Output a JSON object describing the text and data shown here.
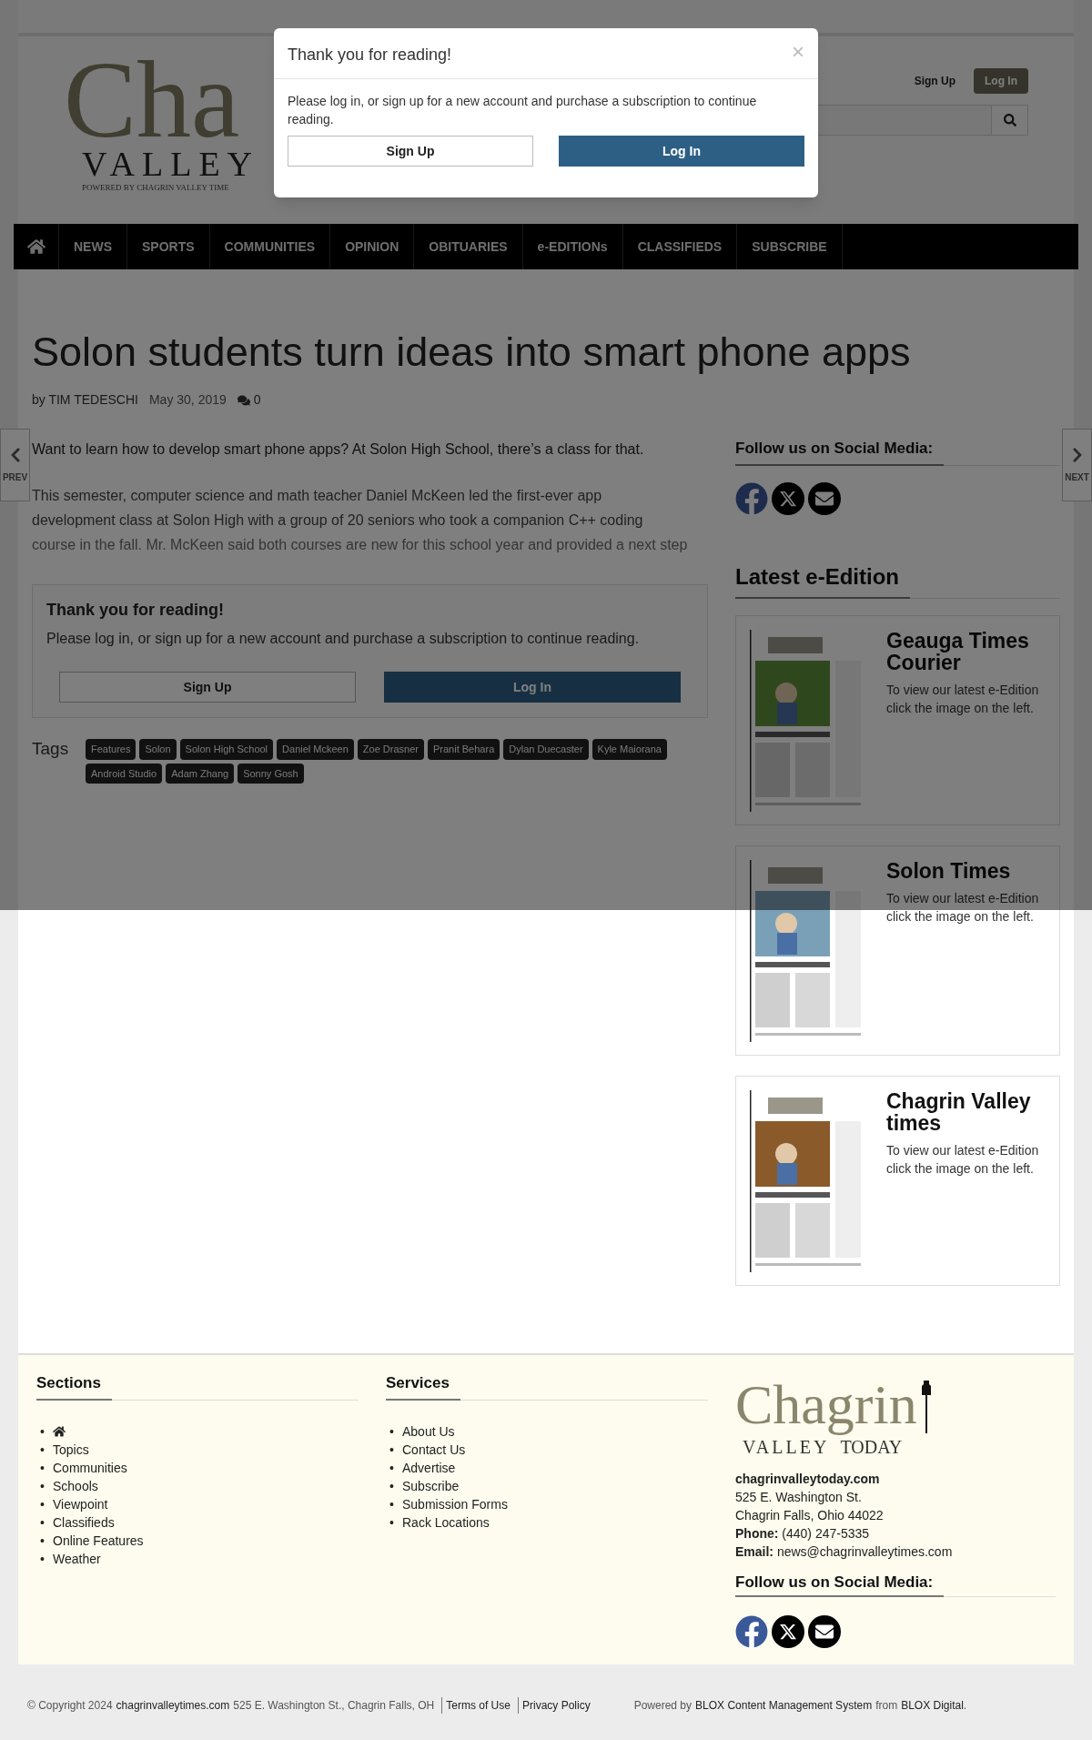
{
  "header": {
    "logo": {
      "line_1": "Cha",
      "line_2": "VALLEY",
      "tagline": "POWERED BY CHAGRIN VALLEY TIME"
    },
    "sign_up": "Sign Up",
    "log_in": "Log In"
  },
  "nav": [
    {
      "kind": "home"
    },
    {
      "kind": "link",
      "label": "NEWS"
    },
    {
      "kind": "link",
      "label": "SPORTS"
    },
    {
      "kind": "link",
      "label": "COMMUNITIES"
    },
    {
      "kind": "link",
      "label": "OPINION"
    },
    {
      "kind": "link",
      "label": "OBITUARIES"
    },
    {
      "kind": "link",
      "label": "e-EDITIONs"
    },
    {
      "kind": "link",
      "label": "CLASSIFIEDS"
    },
    {
      "kind": "link",
      "label": "SUBSCRIBE"
    }
  ],
  "pager": {
    "prev": "PREV",
    "next": "NEXT"
  },
  "article": {
    "title": "Solon students turn ideas into smart phone apps",
    "author": "by TIM TEDESCHI",
    "date": "May 30, 2019",
    "comments": "0",
    "paragraphs": [
      "Want to learn how to develop smart phone apps? At Solon High School, there’s a class for that.",
      "This semester, computer science and math teacher Daniel McKeen led the first-ever app development class at Solon High with a group of 20 seniors who took a companion C++ coding",
      "course in the fall. Mr. McKeen said both courses are new for this school year and provided a next step"
    ]
  },
  "paywall": {
    "title": "Thank you for reading!",
    "text": "Please log in, or sign up for a new account and purchase a subscription to continue reading.",
    "sign_up": "Sign Up",
    "log_in": "Log In"
  },
  "tags": {
    "label": "Tags",
    "items": [
      "Features",
      "Solon",
      "Solon High School",
      "Daniel Mckeen",
      "Zoe Drasner",
      "Pranit Behara",
      "Dylan Duecaster",
      "Kyle Maiorana",
      "Android Studio",
      "Adam Zhang",
      "Sonny Gosh"
    ]
  },
  "sidebar": {
    "social_heading": "Follow us on Social Media:",
    "social": [
      {
        "kind": "facebook"
      },
      {
        "kind": "x"
      },
      {
        "kind": "email"
      }
    ],
    "editions_heading": "Latest e-Edition",
    "editions": [
      {
        "title": "Geauga Times Courier",
        "text": "To view our latest e-Edition click the image on the left."
      },
      {
        "title": "Solon Times",
        "text": "To view our latest e-Edition click the image on the left."
      },
      {
        "title": "Chagrin Valley times",
        "text": "To view our latest e-Edition click the image on the left."
      }
    ]
  },
  "footer": {
    "sections": {
      "heading": "Sections",
      "marker": "•",
      "items": [
        {
          "kind": "home"
        },
        {
          "kind": "link",
          "label": "Topics"
        },
        {
          "kind": "link",
          "label": "Communities"
        },
        {
          "kind": "link",
          "label": "Schools"
        },
        {
          "kind": "link",
          "label": "Viewpoint"
        },
        {
          "kind": "link",
          "label": "Classifieds"
        },
        {
          "kind": "link",
          "label": "Online Features"
        },
        {
          "kind": "link",
          "label": "Weather"
        }
      ]
    },
    "services": {
      "heading": "Services",
      "marker": "•",
      "items": [
        "About Us",
        "Contact Us",
        "Advertise",
        "Subscribe",
        "Submission Forms",
        "Rack Locations"
      ]
    },
    "logo": {
      "word": "Chagrin",
      "left": "VALLEY",
      "right": "TODAY"
    },
    "site": "chagrinvalleytoday.com",
    "address_1": "525 E. Washington St.",
    "address_2": "Chagrin Falls, Ohio 44022",
    "phone_label": "Phone:",
    "phone": "(440) 247-5335",
    "email_label": "Email:",
    "email": "news@chagrinvalleytimes.com",
    "social_heading": "Follow us on Social Media:",
    "social": [
      {
        "kind": "facebook"
      },
      {
        "kind": "x"
      },
      {
        "kind": "email"
      }
    ]
  },
  "bottom": {
    "copyright": "© Copyright 2024",
    "site": "chagrinvalleytimes.com",
    "address": "525 E. Washington St., Chagrin Falls, OH",
    "terms": "Terms of Use",
    "privacy": "Privacy Policy",
    "powered": "Powered by",
    "cms": "BLOX Content Management System",
    "from": "from",
    "vendor": "BLOX Digital",
    "end": "."
  },
  "modal": {
    "title": "Thank you for reading!",
    "close": "×",
    "text": "Please log in, or sign up for a new account and purchase a subscription to continue reading.",
    "sign_up": "Sign Up",
    "log_in": "Log In"
  }
}
